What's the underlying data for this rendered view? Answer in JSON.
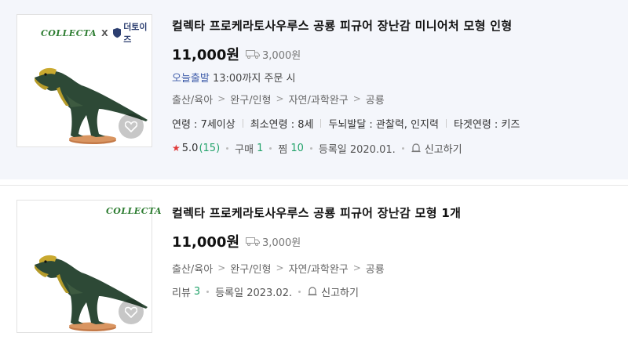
{
  "items": [
    {
      "brand_collecta": "COLLECTA",
      "brand_x": "X",
      "brand_toys": "더토이즈",
      "title": "컬렉타 프로케라토사우루스 공룡 피규어 장난감 미니어처 모형 인형",
      "price": "11,000원",
      "shipping": "3,000원",
      "today_label": "오늘출발",
      "today_text": " 13:00까지 주문 시",
      "categories": [
        "출산/육아",
        "완구/인형",
        "자연/과학완구",
        "공룡"
      ],
      "specs": [
        "연령 : 7세이상",
        "최소연령 : 8세",
        "두뇌발달 : 관찰력, 인지력",
        "타겟연령 : 키즈"
      ],
      "rating": "5.0",
      "rating_count": "(15)",
      "purchase_label": "구매",
      "purchase_count": "1",
      "wish_label": "찜",
      "wish_count": "10",
      "reg_date": "등록일 2020.01.",
      "report": "신고하기"
    },
    {
      "brand_collecta": "COLLECTA",
      "title": "컬렉타 프로케라토사우루스 공룡 피규어 장난감 모형 1개",
      "price": "11,000원",
      "shipping": "3,000원",
      "categories": [
        "출산/육아",
        "완구/인형",
        "자연/과학완구",
        "공룡"
      ],
      "review_label": "리뷰",
      "review_count": "3",
      "reg_date": "등록일 2023.02.",
      "report": "신고하기"
    }
  ],
  "colors": {
    "green": "#23a36b",
    "today_blue": "#3d5ba9",
    "star_red": "#e03a3a",
    "highlight_bg": "#f4f6fb"
  },
  "icons": [
    "truck-icon",
    "heart-icon",
    "star-icon",
    "bell-report-icon",
    "shield-icon"
  ]
}
